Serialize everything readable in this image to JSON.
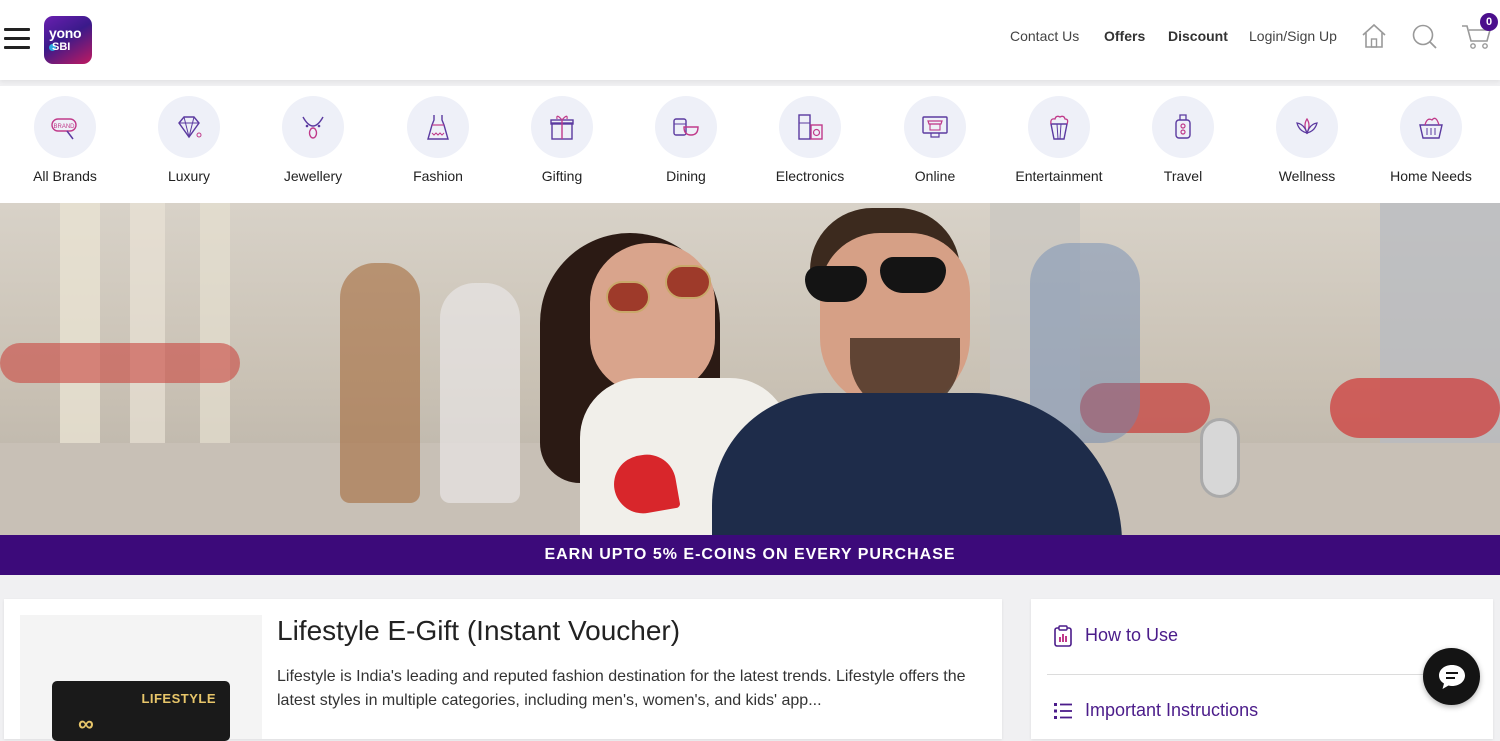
{
  "header": {
    "logo_line1": "yono",
    "logo_line2": "SBI",
    "nav": [
      "Contact Us",
      "Offers",
      "Discount",
      "Login/Sign Up"
    ],
    "cart_count": "0"
  },
  "categories": [
    {
      "label": "All Brands",
      "icon": "brand-tag-icon"
    },
    {
      "label": "Luxury",
      "icon": "diamond-icon"
    },
    {
      "label": "Jewellery",
      "icon": "necklace-icon"
    },
    {
      "label": "Fashion",
      "icon": "dress-icon"
    },
    {
      "label": "Gifting",
      "icon": "gift-icon"
    },
    {
      "label": "Dining",
      "icon": "dining-icon"
    },
    {
      "label": "Electronics",
      "icon": "appliance-icon"
    },
    {
      "label": "Online",
      "icon": "online-shop-icon"
    },
    {
      "label": "Entertainment",
      "icon": "popcorn-icon"
    },
    {
      "label": "Travel",
      "icon": "luggage-icon"
    },
    {
      "label": "Wellness",
      "icon": "lotus-icon"
    },
    {
      "label": "Home Needs",
      "icon": "basket-icon"
    }
  ],
  "banner": {
    "promo_text": "EARN UPTO 5% E-COINS ON EVERY PURCHASE"
  },
  "product": {
    "title": "Lifestyle E-Gift (Instant Voucher)",
    "description": "Lifestyle is India's leading and reputed fashion destination for the latest trends. Lifestyle offers the latest styles in multiple categories, including men's, women's, and kids' app...",
    "card_brand": "LIFESTYLE",
    "card_symbol": "∞"
  },
  "side": {
    "how_to_use": "How to Use",
    "important_instructions": "Important Instructions"
  },
  "colors": {
    "brand_purple": "#3c0a7a",
    "link_purple": "#4b1c8a",
    "category_circle": "#eef0f8"
  }
}
